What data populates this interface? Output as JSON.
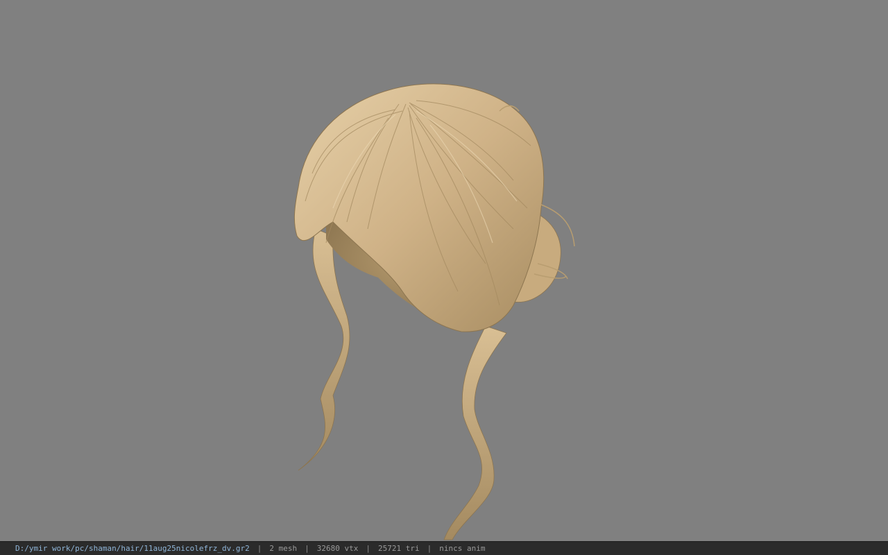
{
  "viewport": {
    "background": "#808080",
    "model": "hair-mesh",
    "hair_colors": {
      "light": "#e3cba2",
      "base": "#c9ab7d",
      "shadow": "#8c7550",
      "deep": "#6f5c3e"
    }
  },
  "statusbar": {
    "path": "D:/ymir work/pc/shaman/hair/11aug25nicolefrz_dv.gr2",
    "separator": "|",
    "mesh": "2 mesh",
    "vtx": "32680 vtx",
    "tri": "25721 tri",
    "anim": "nincs anim"
  }
}
